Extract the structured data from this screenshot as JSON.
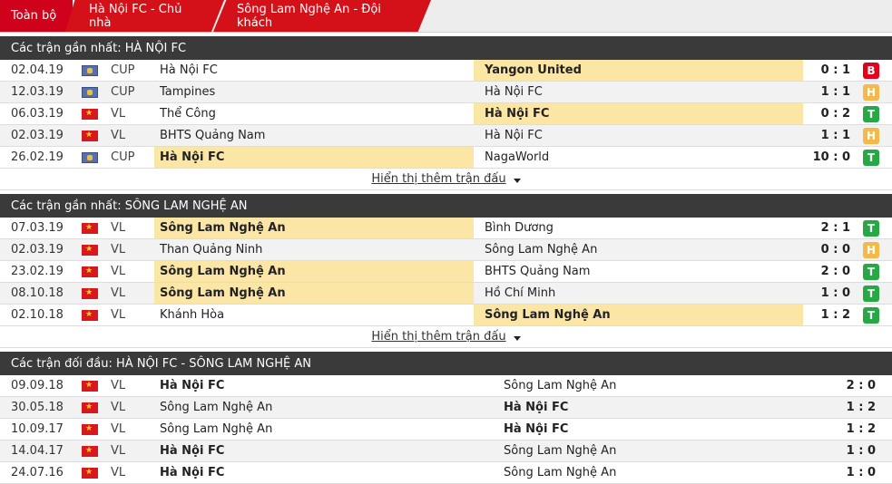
{
  "tabs": [
    "Toàn bộ",
    "Hà Nội FC - Chủ nhà",
    "Sông Lam Nghệ An - Đội khách"
  ],
  "more_label": "Hiển thị thêm trận đấu",
  "sections": [
    {
      "title": "Các trận gần nhất: HÀ NỘI FC",
      "rows": [
        {
          "date": "02.04.19",
          "flag": "world",
          "comp": "CUP",
          "home": "Hà Nội FC",
          "away": "Yangon United",
          "score": "0 : 1",
          "result": "B",
          "hl": "away"
        },
        {
          "date": "12.03.19",
          "flag": "world",
          "comp": "CUP",
          "home": "Tampines",
          "away": "Hà Nội FC",
          "score": "1 : 1",
          "result": "H",
          "hl": "none"
        },
        {
          "date": "06.03.19",
          "flag": "vn",
          "comp": "VL",
          "home": "Thể Công",
          "away": "Hà Nội FC",
          "score": "0 : 2",
          "result": "T",
          "hl": "away"
        },
        {
          "date": "02.03.19",
          "flag": "vn",
          "comp": "VL",
          "home": "BHTS Quảng Nam",
          "away": "Hà Nội FC",
          "score": "1 : 1",
          "result": "H",
          "hl": "none"
        },
        {
          "date": "26.02.19",
          "flag": "world",
          "comp": "CUP",
          "home": "Hà Nội FC",
          "away": "NagaWorld",
          "score": "10 : 0",
          "result": "T",
          "hl": "home"
        }
      ]
    },
    {
      "title": "Các trận gần nhất: SÔNG LAM NGHỆ AN",
      "rows": [
        {
          "date": "07.03.19",
          "flag": "vn",
          "comp": "VL",
          "home": "Sông Lam Nghệ An",
          "away": "Bình Dương",
          "score": "2 : 1",
          "result": "T",
          "hl": "home"
        },
        {
          "date": "02.03.19",
          "flag": "vn",
          "comp": "VL",
          "home": "Than Quảng Ninh",
          "away": "Sông Lam Nghệ An",
          "score": "0 : 0",
          "result": "H",
          "hl": "none"
        },
        {
          "date": "23.02.19",
          "flag": "vn",
          "comp": "VL",
          "home": "Sông Lam Nghệ An",
          "away": "BHTS Quảng Nam",
          "score": "2 : 0",
          "result": "T",
          "hl": "home"
        },
        {
          "date": "08.10.18",
          "flag": "vn",
          "comp": "VL",
          "home": "Sông Lam Nghệ An",
          "away": "Hồ Chí Minh",
          "score": "1 : 0",
          "result": "T",
          "hl": "home"
        },
        {
          "date": "02.10.18",
          "flag": "vn",
          "comp": "VL",
          "home": "Khánh Hòa",
          "away": "Sông Lam Nghệ An",
          "score": "1 : 2",
          "result": "T",
          "hl": "away"
        }
      ]
    },
    {
      "title": "Các trận đối đầu: HÀ NỘI FC - SÔNG LAM NGHỆ AN",
      "rows": [
        {
          "date": "09.09.18",
          "flag": "vn",
          "comp": "VL",
          "home": "Hà Nội FC",
          "away": "Sông Lam Nghệ An",
          "score": "2 : 0",
          "bold": "home"
        },
        {
          "date": "30.05.18",
          "flag": "vn",
          "comp": "VL",
          "home": "Sông Lam Nghệ An",
          "away": "Hà Nội FC",
          "score": "1 : 2",
          "bold": "away"
        },
        {
          "date": "10.09.17",
          "flag": "vn",
          "comp": "VL",
          "home": "Sông Lam Nghệ An",
          "away": "Hà Nội FC",
          "score": "1 : 2",
          "bold": "away"
        },
        {
          "date": "14.04.17",
          "flag": "vn",
          "comp": "VL",
          "home": "Hà Nội FC",
          "away": "Sông Lam Nghệ An",
          "score": "1 : 0",
          "bold": "home"
        },
        {
          "date": "24.07.16",
          "flag": "vn",
          "comp": "VL",
          "home": "Hà Nội FC",
          "away": "Sông Lam Nghệ An",
          "score": "1 : 0",
          "bold": "home"
        }
      ]
    }
  ]
}
